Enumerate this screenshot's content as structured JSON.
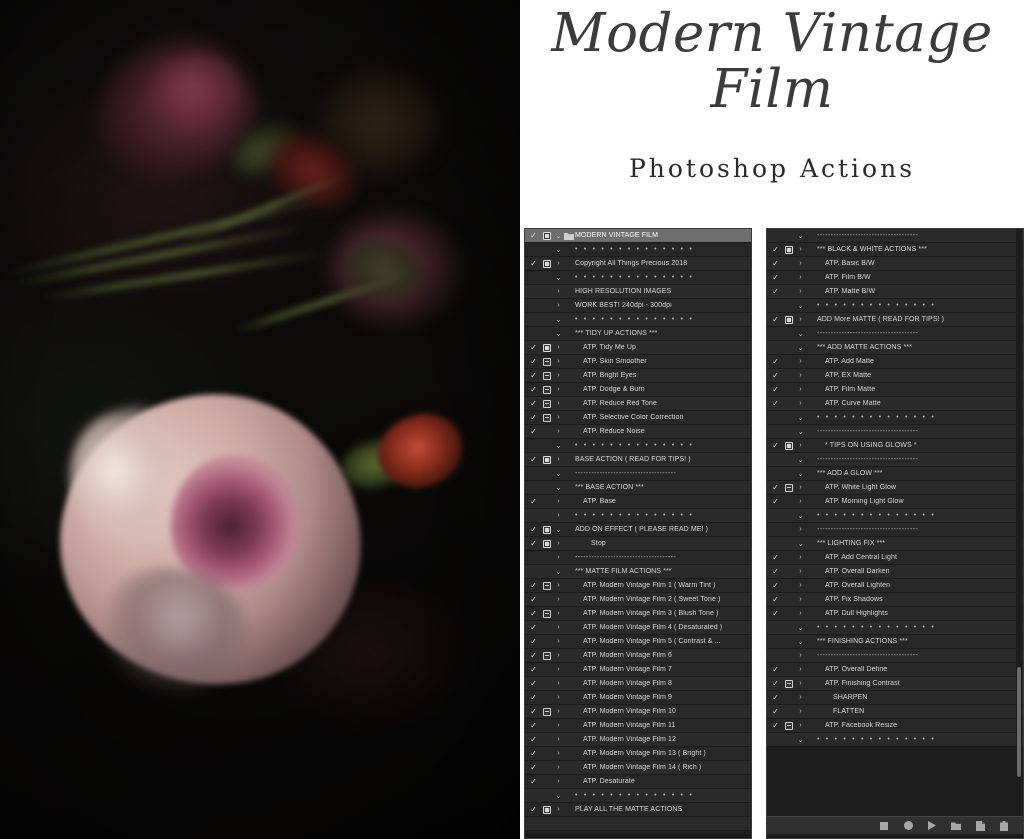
{
  "product": {
    "title_line1": "Modern Vintage",
    "title_line2": "Film",
    "subtitle": "Photoshop Actions"
  },
  "photo": {
    "alt": "dark moody photograph of pale pink garden roses"
  },
  "panels": {
    "scrollbar_present": true,
    "toolbar_icons": [
      "stop-icon",
      "record-icon",
      "play-icon",
      "folder-icon",
      "new-action-icon",
      "trash-icon"
    ],
    "dots_separator": "• • • • • • • • • • • • • •",
    "dashes_separator": "-------------------------------------",
    "left": {
      "rows": [
        {
          "check": true,
          "box": "mod",
          "tw": "v",
          "folder": true,
          "label": "MODERN VINTAGE FILM",
          "indent": 0,
          "selected": true
        },
        {
          "check": false,
          "box": "none",
          "tw": "v",
          "folder": false,
          "label": "• • • • • • • • • • • • • •",
          "indent": 0,
          "kind": "dots"
        },
        {
          "check": true,
          "box": "mod",
          "tw": ">",
          "folder": false,
          "label": "Copyright All Things Precious 2018",
          "indent": 0
        },
        {
          "check": false,
          "box": "none",
          "tw": "v",
          "folder": false,
          "label": "• • • • • • • • • • • • • •",
          "indent": 0,
          "kind": "dots"
        },
        {
          "check": false,
          "box": "none",
          "tw": ">",
          "folder": false,
          "label": "HIGH RESOLUTION IMAGES",
          "indent": 0
        },
        {
          "check": false,
          "box": "none",
          "tw": ">",
          "folder": false,
          "label": "WORK BEST!  240dpi - 300dpi",
          "indent": 0
        },
        {
          "check": false,
          "box": "none",
          "tw": "v",
          "folder": false,
          "label": "• • • • • • • • • • • • • •",
          "indent": 0,
          "kind": "dots"
        },
        {
          "check": false,
          "box": "none",
          "tw": "v",
          "folder": false,
          "label": "*** TIDY UP ACTIONS ***",
          "indent": 0
        },
        {
          "check": true,
          "box": "mod",
          "tw": ">",
          "folder": false,
          "label": "ATP. Tidy Me Up",
          "indent": 1
        },
        {
          "check": true,
          "box": "modsmall",
          "tw": ">",
          "folder": false,
          "label": "ATP. Skin Smoother",
          "indent": 1
        },
        {
          "check": true,
          "box": "modsmall",
          "tw": ">",
          "folder": false,
          "label": "ATP. Bright Eyes",
          "indent": 1
        },
        {
          "check": true,
          "box": "modsmall",
          "tw": ">",
          "folder": false,
          "label": "ATP. Dodge & Burn",
          "indent": 1
        },
        {
          "check": true,
          "box": "modsmall",
          "tw": ">",
          "folder": false,
          "label": "ATP. Reduce Red Tone",
          "indent": 1
        },
        {
          "check": true,
          "box": "modsmall",
          "tw": ">",
          "folder": false,
          "label": "ATP. Selective Color Correction",
          "indent": 1
        },
        {
          "check": true,
          "box": "none",
          "tw": ">",
          "folder": false,
          "label": "ATP. Reduce Noise",
          "indent": 1
        },
        {
          "check": false,
          "box": "none",
          "tw": "v",
          "folder": false,
          "label": "• • • • • • • • • • • • • •",
          "indent": 0,
          "kind": "dots"
        },
        {
          "check": true,
          "box": "mod",
          "tw": ">",
          "folder": false,
          "label": "BASE ACTION ( READ FOR TIPS! )",
          "indent": 0
        },
        {
          "check": false,
          "box": "none",
          "tw": "v",
          "folder": false,
          "label": "-------------------------------------",
          "indent": 0,
          "kind": "dashes"
        },
        {
          "check": false,
          "box": "none",
          "tw": "v",
          "folder": false,
          "label": "*** BASE ACTION ***",
          "indent": 0
        },
        {
          "check": true,
          "box": "none",
          "tw": ">",
          "folder": false,
          "label": "ATP. Base",
          "indent": 1
        },
        {
          "check": false,
          "box": "none",
          "tw": ">",
          "folder": false,
          "label": "• • • • • • • • • • • • • •",
          "indent": 0,
          "kind": "dots"
        },
        {
          "check": true,
          "box": "mod",
          "tw": "v",
          "folder": false,
          "label": "ADD ON EFFECT ( PLEASE READ ME! )",
          "indent": 0
        },
        {
          "check": true,
          "box": "mod",
          "tw": ">",
          "folder": false,
          "label": "Stop",
          "indent": 2
        },
        {
          "check": false,
          "box": "none",
          "tw": ">",
          "folder": false,
          "label": "-------------------------------------",
          "indent": 0,
          "kind": "dashes"
        },
        {
          "check": false,
          "box": "none",
          "tw": "v",
          "folder": false,
          "label": "*** MATTE FILM ACTIONS ***",
          "indent": 0
        },
        {
          "check": true,
          "box": "modsmall",
          "tw": ">",
          "folder": false,
          "label": "ATP. Modern Vintage Film 1 ( Warm Tint )",
          "indent": 1
        },
        {
          "check": true,
          "box": "none",
          "tw": ">",
          "folder": false,
          "label": "ATP. Modern Vintage Film 2 ( Sweet Tone )",
          "indent": 1
        },
        {
          "check": true,
          "box": "modsmall",
          "tw": ">",
          "folder": false,
          "label": "ATP. Modern Vintage Film 3 ( Blush Tone )",
          "indent": 1
        },
        {
          "check": true,
          "box": "none",
          "tw": ">",
          "folder": false,
          "label": "ATP. Modern Vintage Film 4 ( Desaturated )",
          "indent": 1
        },
        {
          "check": true,
          "box": "none",
          "tw": ">",
          "folder": false,
          "label": "ATP. Modern Vintage Film 5 ( Contrast & ...",
          "indent": 1
        },
        {
          "check": true,
          "box": "modsmall",
          "tw": ">",
          "folder": false,
          "label": "ATP. Modern Vintage Film 6",
          "indent": 1
        },
        {
          "check": true,
          "box": "none",
          "tw": ">",
          "folder": false,
          "label": "ATP. Modern Vintage Film 7",
          "indent": 1
        },
        {
          "check": true,
          "box": "none",
          "tw": ">",
          "folder": false,
          "label": "ATP. Modern Vintage Film 8",
          "indent": 1
        },
        {
          "check": true,
          "box": "none",
          "tw": ">",
          "folder": false,
          "label": "ATP. Modern Vintage Film 9",
          "indent": 1
        },
        {
          "check": true,
          "box": "modsmall",
          "tw": ">",
          "folder": false,
          "label": "ATP. Modern Vintage Film 10",
          "indent": 1
        },
        {
          "check": true,
          "box": "none",
          "tw": ">",
          "folder": false,
          "label": "ATP. Modern Vintage Film 11",
          "indent": 1
        },
        {
          "check": true,
          "box": "none",
          "tw": ">",
          "folder": false,
          "label": "ATP. Modern Vintage Film 12",
          "indent": 1
        },
        {
          "check": true,
          "box": "none",
          "tw": ">",
          "folder": false,
          "label": "ATP. Modern Vintage Film 13 ( Bright )",
          "indent": 1
        },
        {
          "check": true,
          "box": "none",
          "tw": ">",
          "folder": false,
          "label": "ATP. Modern Vintage Film 14 ( Rich )",
          "indent": 1
        },
        {
          "check": true,
          "box": "none",
          "tw": ">",
          "folder": false,
          "label": "ATP. Desaturate",
          "indent": 1
        },
        {
          "check": false,
          "box": "none",
          "tw": "v",
          "folder": false,
          "label": "• • • • • • • • • • • • • •",
          "indent": 0,
          "kind": "dots"
        },
        {
          "check": true,
          "box": "mod",
          "tw": ">",
          "folder": false,
          "label": "PLAY ALL THE MATTE ACTIONS",
          "indent": 0
        },
        {
          "check": false,
          "box": "none",
          "tw": "",
          "folder": false,
          "label": "",
          "indent": 0
        }
      ]
    },
    "right": {
      "rows": [
        {
          "check": false,
          "box": "none",
          "tw": "v",
          "folder": false,
          "label": "-------------------------------------",
          "indent": 0,
          "kind": "dashes"
        },
        {
          "check": true,
          "box": "mod",
          "tw": ">",
          "folder": false,
          "label": "*** BLACK & WHITE ACTIONS ***",
          "indent": 0
        },
        {
          "check": true,
          "box": "none",
          "tw": ">",
          "folder": false,
          "label": "ATP. Basic B/W",
          "indent": 1
        },
        {
          "check": true,
          "box": "none",
          "tw": ">",
          "folder": false,
          "label": "ATP. Film B/W",
          "indent": 1
        },
        {
          "check": true,
          "box": "none",
          "tw": ">",
          "folder": false,
          "label": "ATP. Matte B/W",
          "indent": 1
        },
        {
          "check": false,
          "box": "none",
          "tw": "v",
          "folder": false,
          "label": "• • • • • • • • • • • • • •",
          "indent": 0,
          "kind": "dots"
        },
        {
          "check": true,
          "box": "mod",
          "tw": ">",
          "folder": false,
          "label": "ADD More MATTE ( READ FOR TIPS! )",
          "indent": 0
        },
        {
          "check": false,
          "box": "none",
          "tw": "v",
          "folder": false,
          "label": "-------------------------------------",
          "indent": 0,
          "kind": "dashes"
        },
        {
          "check": false,
          "box": "none",
          "tw": "v",
          "folder": false,
          "label": "*** ADD MATTE ACTIONS ***",
          "indent": 0
        },
        {
          "check": true,
          "box": "none",
          "tw": ">",
          "folder": false,
          "label": "ATP. Add  Matte",
          "indent": 1
        },
        {
          "check": true,
          "box": "none",
          "tw": ">",
          "folder": false,
          "label": "ATP. EX Matte",
          "indent": 1
        },
        {
          "check": true,
          "box": "none",
          "tw": ">",
          "folder": false,
          "label": "ATP. Film Matte",
          "indent": 1
        },
        {
          "check": true,
          "box": "none",
          "tw": ">",
          "folder": false,
          "label": "ATP. Curve Matte",
          "indent": 1
        },
        {
          "check": false,
          "box": "none",
          "tw": "v",
          "folder": false,
          "label": "• • • • • • • • • • • • • •",
          "indent": 0,
          "kind": "dots"
        },
        {
          "check": false,
          "box": "none",
          "tw": "v",
          "folder": false,
          "label": "-------------------------------------",
          "indent": 0,
          "kind": "dashes"
        },
        {
          "check": true,
          "box": "mod",
          "tw": ">",
          "folder": false,
          "label": "*   TIPS ON USING GLOWS   *",
          "indent": 1
        },
        {
          "check": false,
          "box": "none",
          "tw": "v",
          "folder": false,
          "label": "-------------------------------------",
          "indent": 0,
          "kind": "dashes"
        },
        {
          "check": false,
          "box": "none",
          "tw": "v",
          "folder": false,
          "label": "*** ADD A GLOW ***",
          "indent": 0
        },
        {
          "check": true,
          "box": "modsmall",
          "tw": ">",
          "folder": false,
          "label": "ATP. White Light Glow",
          "indent": 1
        },
        {
          "check": true,
          "box": "none",
          "tw": ">",
          "folder": false,
          "label": "ATP. Morning Light Glow",
          "indent": 1
        },
        {
          "check": false,
          "box": "none",
          "tw": "v",
          "folder": false,
          "label": "• • • • • • • • • • • • • •",
          "indent": 0,
          "kind": "dots"
        },
        {
          "check": false,
          "box": "none",
          "tw": ">",
          "folder": false,
          "label": "-------------------------------------",
          "indent": 0,
          "kind": "dashes"
        },
        {
          "check": false,
          "box": "none",
          "tw": "v",
          "folder": false,
          "label": "*** LIGHTING FIX ***",
          "indent": 0
        },
        {
          "check": true,
          "box": "none",
          "tw": ">",
          "folder": false,
          "label": "ATP. Add Central Light",
          "indent": 1
        },
        {
          "check": true,
          "box": "none",
          "tw": ">",
          "folder": false,
          "label": "ATP. Overall Darken",
          "indent": 1
        },
        {
          "check": true,
          "box": "none",
          "tw": ">",
          "folder": false,
          "label": "ATP. Overall Lighten",
          "indent": 1
        },
        {
          "check": true,
          "box": "none",
          "tw": ">",
          "folder": false,
          "label": "ATP. Fix Shadows",
          "indent": 1
        },
        {
          "check": true,
          "box": "none",
          "tw": ">",
          "folder": false,
          "label": "ATP. Dull Highlights",
          "indent": 1
        },
        {
          "check": false,
          "box": "none",
          "tw": "v",
          "folder": false,
          "label": "• • • • • • • • • • • • • •",
          "indent": 0,
          "kind": "dots"
        },
        {
          "check": false,
          "box": "none",
          "tw": "v",
          "folder": false,
          "label": "*** FINISHING ACTIONS ***",
          "indent": 0
        },
        {
          "check": false,
          "box": "none",
          "tw": ">",
          "folder": false,
          "label": "-------------------------------------",
          "indent": 0,
          "kind": "dashes"
        },
        {
          "check": true,
          "box": "none",
          "tw": ">",
          "folder": false,
          "label": "ATP. Overall Define",
          "indent": 1
        },
        {
          "check": true,
          "box": "modsmall",
          "tw": ">",
          "folder": false,
          "label": "ATP. Finishing Contrast",
          "indent": 1
        },
        {
          "check": true,
          "box": "none",
          "tw": ">",
          "folder": false,
          "label": "SHARPEN",
          "indent": 2
        },
        {
          "check": true,
          "box": "none",
          "tw": ">",
          "folder": false,
          "label": "FLATTEN",
          "indent": 2
        },
        {
          "check": true,
          "box": "modsmall",
          "tw": ">",
          "folder": false,
          "label": "ATP. Facebook Resize",
          "indent": 1
        },
        {
          "check": false,
          "box": "none",
          "tw": "v",
          "folder": false,
          "label": "• • • • • • • • • • • • • •",
          "indent": 0,
          "kind": "dots"
        }
      ]
    }
  }
}
